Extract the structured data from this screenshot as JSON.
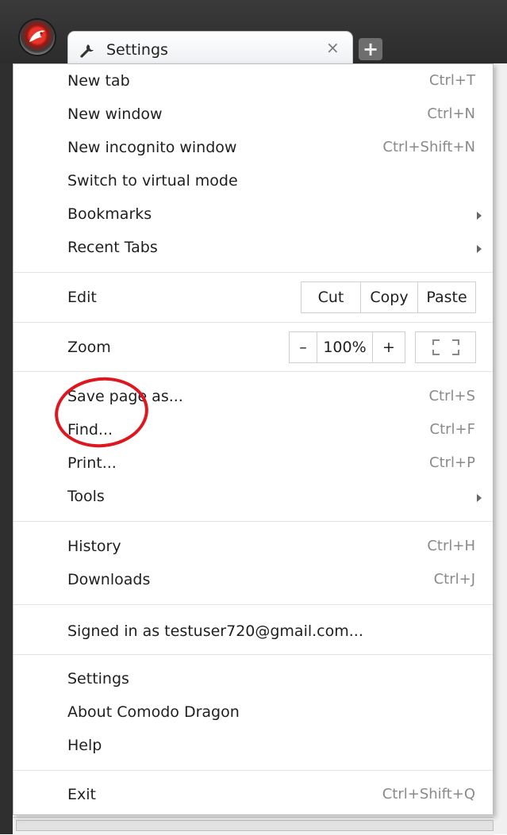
{
  "tab": {
    "title": "Settings",
    "close": "×",
    "new_tab": "+"
  },
  "menu": {
    "items1": [
      {
        "label": "New tab",
        "shortcut": "Ctrl+T"
      },
      {
        "label": "New window",
        "shortcut": "Ctrl+N"
      },
      {
        "label": "New incognito window",
        "shortcut": "Ctrl+Shift+N"
      },
      {
        "label": "Switch to virtual mode",
        "shortcut": ""
      },
      {
        "label": "Bookmarks",
        "shortcut": ""
      },
      {
        "label": "Recent Tabs",
        "shortcut": ""
      }
    ],
    "edit": {
      "label": "Edit",
      "cut": "Cut",
      "copy": "Copy",
      "paste": "Paste"
    },
    "zoom": {
      "label": "Zoom",
      "minus": "–",
      "level": "100%",
      "plus": "+"
    },
    "items2": [
      {
        "label": "Save page as...",
        "shortcut": "Ctrl+S"
      },
      {
        "label": "Find...",
        "shortcut": "Ctrl+F"
      },
      {
        "label": "Print...",
        "shortcut": "Ctrl+P"
      },
      {
        "label": "Tools",
        "shortcut": ""
      }
    ],
    "items3": [
      {
        "label": "History",
        "shortcut": "Ctrl+H"
      },
      {
        "label": "Downloads",
        "shortcut": "Ctrl+J"
      }
    ],
    "signed_in": "Signed in as testuser720@gmail.com...",
    "items4": [
      {
        "label": "Settings"
      },
      {
        "label": "About Comodo Dragon"
      },
      {
        "label": "Help"
      }
    ],
    "exit": {
      "label": "Exit",
      "shortcut": "Ctrl+Shift+Q"
    }
  },
  "colors": {
    "highlight": "#e0161f",
    "chrome": "#2f2f2f",
    "shortcut_text": "#8a8a8a"
  }
}
